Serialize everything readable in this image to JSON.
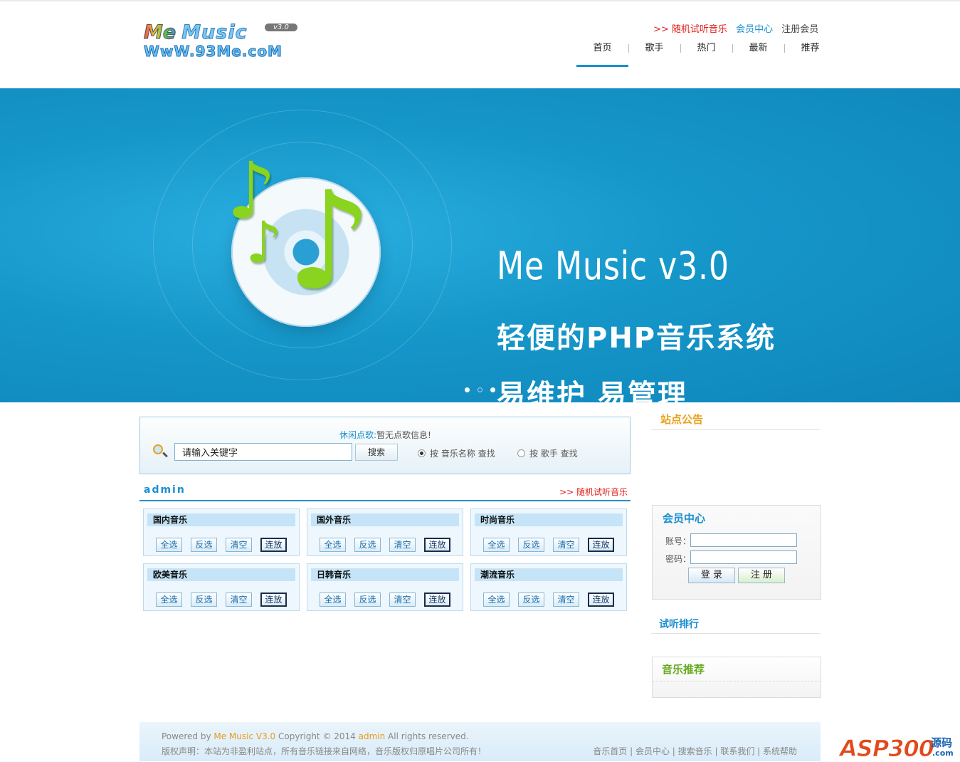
{
  "header": {
    "logo_line1_me": "Me",
    "logo_line1_music": "Music",
    "logo_version": "v3.0",
    "logo_line2": "WwW.93Me.coM",
    "top_links": {
      "random": ">> 随机试听音乐",
      "member_center": "会员中心",
      "register": "注册会员"
    },
    "nav": [
      "首页",
      "歌手",
      "热门",
      "最新",
      "推荐"
    ],
    "active_nav": "首页"
  },
  "banner": {
    "title": "Me Music v3.0",
    "line2": "轻便的PHP音乐系统",
    "line3": "易维护 易管理",
    "slides": 3,
    "current_slide": 2
  },
  "search": {
    "tip_label": "休闲点歌:",
    "tip_value": "暂无点歌信息!",
    "input_value": "请输入关键字",
    "button": "搜索",
    "option_name": "按 音乐名称 查找",
    "option_singer": "按 歌手 查找",
    "selected_option": "name"
  },
  "section": {
    "user": "admin",
    "random": ">> 随机试听音乐"
  },
  "categories": [
    {
      "name": "国内音乐"
    },
    {
      "name": "国外音乐"
    },
    {
      "name": "时尚音乐"
    },
    {
      "name": "欧美音乐"
    },
    {
      "name": "日韩音乐"
    },
    {
      "name": "潮流音乐"
    }
  ],
  "category_buttons": [
    "全选",
    "反选",
    "清空",
    "连放"
  ],
  "sidebar": {
    "notice_title": "站点公告",
    "member_title": "会员中心",
    "account_label": "账号：",
    "password_label": "密码：",
    "login": "登 录",
    "register": "注 册",
    "ranking_title": "试听排行",
    "recommend_title": "音乐推荐",
    "colors": {
      "notice": "#e8a21c",
      "ranking": "#1a8ed0",
      "recommend": "#67a91d"
    }
  },
  "footer": {
    "powered": "Powered by ",
    "product": "Me Music V3.0",
    "copyright": " Copyright © 2014 ",
    "owner": "admin",
    "rights": " All rights reserved.",
    "disclaimer": "版权声明：本站为非盈利站点，所有音乐链接来自网络，音乐版权归原唱片公司所有！",
    "links": "音乐首页 | 会员中心 | 搜索音乐 | 联系我们 | 系统帮助"
  },
  "watermark": {
    "brand": "ASP300",
    "cn": "源码",
    "domain": ".com"
  },
  "colors": {
    "accent": "#1a8ed0",
    "red": "#e0201b",
    "banner": "#1596c9"
  }
}
